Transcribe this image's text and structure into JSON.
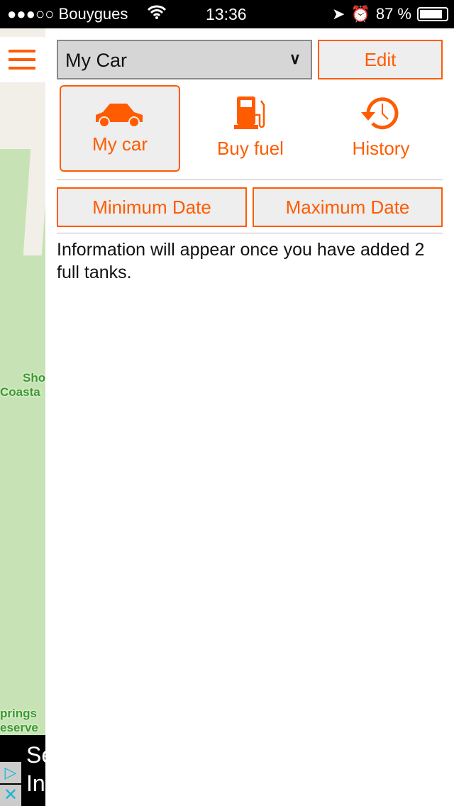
{
  "status_bar": {
    "carrier": "●●●○○ Bouygues",
    "time": "13:36",
    "battery": "87 %",
    "battery_level": 0.87
  },
  "map": {
    "labels": [
      "Sho",
      "Coasta",
      "prings",
      "eserve"
    ]
  },
  "ad": {
    "line1": "Se",
    "line2": "In"
  },
  "header": {
    "car_select": "My Car",
    "edit_label": "Edit"
  },
  "tabs": [
    {
      "label": "My car",
      "icon": "car-icon",
      "active": true
    },
    {
      "label": "Buy fuel",
      "icon": "fuel-pump-icon"
    },
    {
      "label": "History",
      "icon": "history-icon"
    }
  ],
  "dates": {
    "min_label": "Minimum Date",
    "max_label": "Maximum Date"
  },
  "info": "Information will appear once you have added 2 full tanks.",
  "colors": {
    "accent": "#ff5b00"
  }
}
